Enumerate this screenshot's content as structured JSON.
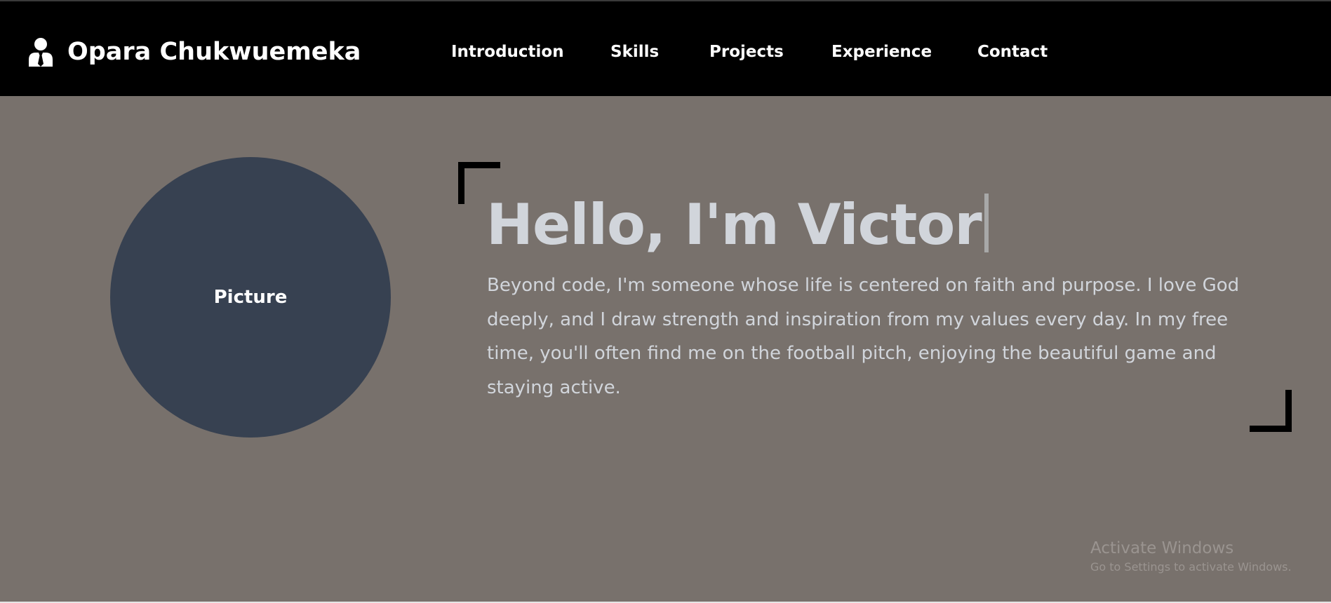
{
  "header": {
    "brand_icon": "user-tie-icon",
    "brand_name": "Opara Chukwuemeka",
    "nav": [
      {
        "label": "Introduction"
      },
      {
        "label": "Skills"
      },
      {
        "label": "Projects"
      },
      {
        "label": "Experience"
      },
      {
        "label": "Contact"
      }
    ]
  },
  "hero": {
    "picture_label": "Picture",
    "headline": "Hello, I'm Victor",
    "bio": "Beyond code, I'm someone whose life is centered on faith and purpose. I love God deeply, and I draw strength and inspiration from my values every day. In my free time, you'll often find me on the football pitch, enjoying the beautiful game and staying active."
  },
  "watermark": {
    "title": "Activate Windows",
    "subtitle": "Go to Settings to activate Windows."
  },
  "colors": {
    "navbar_bg": "#000000",
    "hero_bg": "#78716c",
    "avatar_bg": "#374151",
    "headline_text": "#d1d5db",
    "accent_corner": "#000000"
  }
}
